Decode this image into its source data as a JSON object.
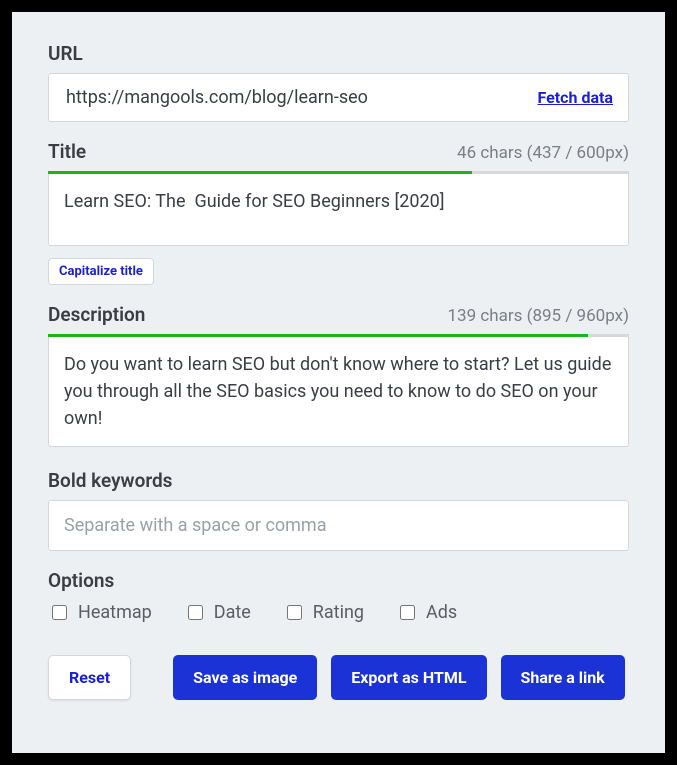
{
  "url": {
    "label": "URL",
    "value": "https://mangools.com/blog/learn-seo",
    "fetch_label": "Fetch data"
  },
  "title": {
    "label": "Title",
    "meta": "46 chars (437 / 600px)",
    "value": "Learn SEO: The  Guide for SEO Beginners [2020]",
    "progress_percent": 73,
    "capitalize_label": "Capitalize title"
  },
  "description": {
    "label": "Description",
    "meta": "139 chars (895 / 960px)",
    "value": "Do you want to learn SEO but don't know where to start? Let us guide you through all the SEO basics you need to know to do SEO on your own!",
    "progress_percent": 93
  },
  "bold_keywords": {
    "label": "Bold keywords",
    "placeholder": "Separate with a space or comma"
  },
  "options": {
    "label": "Options",
    "items": [
      {
        "label": "Heatmap"
      },
      {
        "label": "Date"
      },
      {
        "label": "Rating"
      },
      {
        "label": "Ads"
      }
    ]
  },
  "buttons": {
    "reset": "Reset",
    "save_image": "Save as image",
    "export_html": "Export as HTML",
    "share_link": "Share a link"
  }
}
